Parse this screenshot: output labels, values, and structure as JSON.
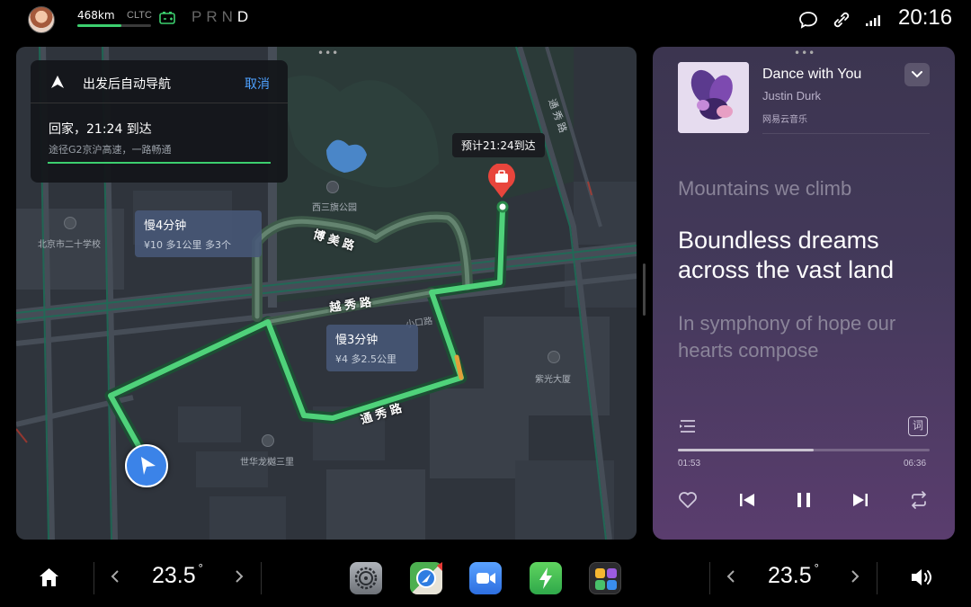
{
  "status_bar": {
    "range": "468km",
    "range_standard": "CLTC",
    "range_fraction": 0.6,
    "gears": [
      "P",
      "R",
      "N",
      "D"
    ],
    "active_gear": "D",
    "time": "20:16"
  },
  "navigation": {
    "title": "出发后自动导航",
    "cancel_label": "取消",
    "eta_text": "回家，21:24 到达",
    "route_desc": "途径G2京沪高速，一路畅通",
    "dest_eta_bubble": "预计21:24到达",
    "alt_route_1": {
      "time": "慢4分钟",
      "detail": "¥10 多1公里  多3个"
    },
    "alt_route_2": {
      "time": "慢3分钟",
      "detail": "¥4 多2.5公里"
    },
    "map_labels": {
      "park": "西三旗公园",
      "school": "北京市二十学校",
      "tower": "紫光大厦",
      "residence": "世华龙樾三里",
      "road_bomei": "博美路",
      "road_yuexiu": "越秀路",
      "road_tongxiu": "通秀路",
      "road_tongxiu_v": "通秀路",
      "road_xiaokou": "小口路"
    }
  },
  "music": {
    "title": "Dance with You",
    "artist": "Justin Durk",
    "source": "网易云音乐",
    "lyric_prev": "Mountains we climb",
    "lyric_current": "Boundless dreams across the vast land",
    "lyric_next": "In symphony of hope our hearts compose",
    "time_current": "01:53",
    "time_total": "06:36",
    "progress": 0.54,
    "lyrics_toggle": "词"
  },
  "dock": {
    "temp_left": "23.5",
    "temp_right": "23.5",
    "degree": "°",
    "apps": [
      "settings-app",
      "maps-app",
      "video-call-app",
      "charging-app",
      "apps-grid"
    ]
  },
  "colors": {
    "route_green": "#4fd27a",
    "accent_blue": "#4ea1ff",
    "destination_red": "#e8453c",
    "car_blue": "#3b83e8"
  }
}
